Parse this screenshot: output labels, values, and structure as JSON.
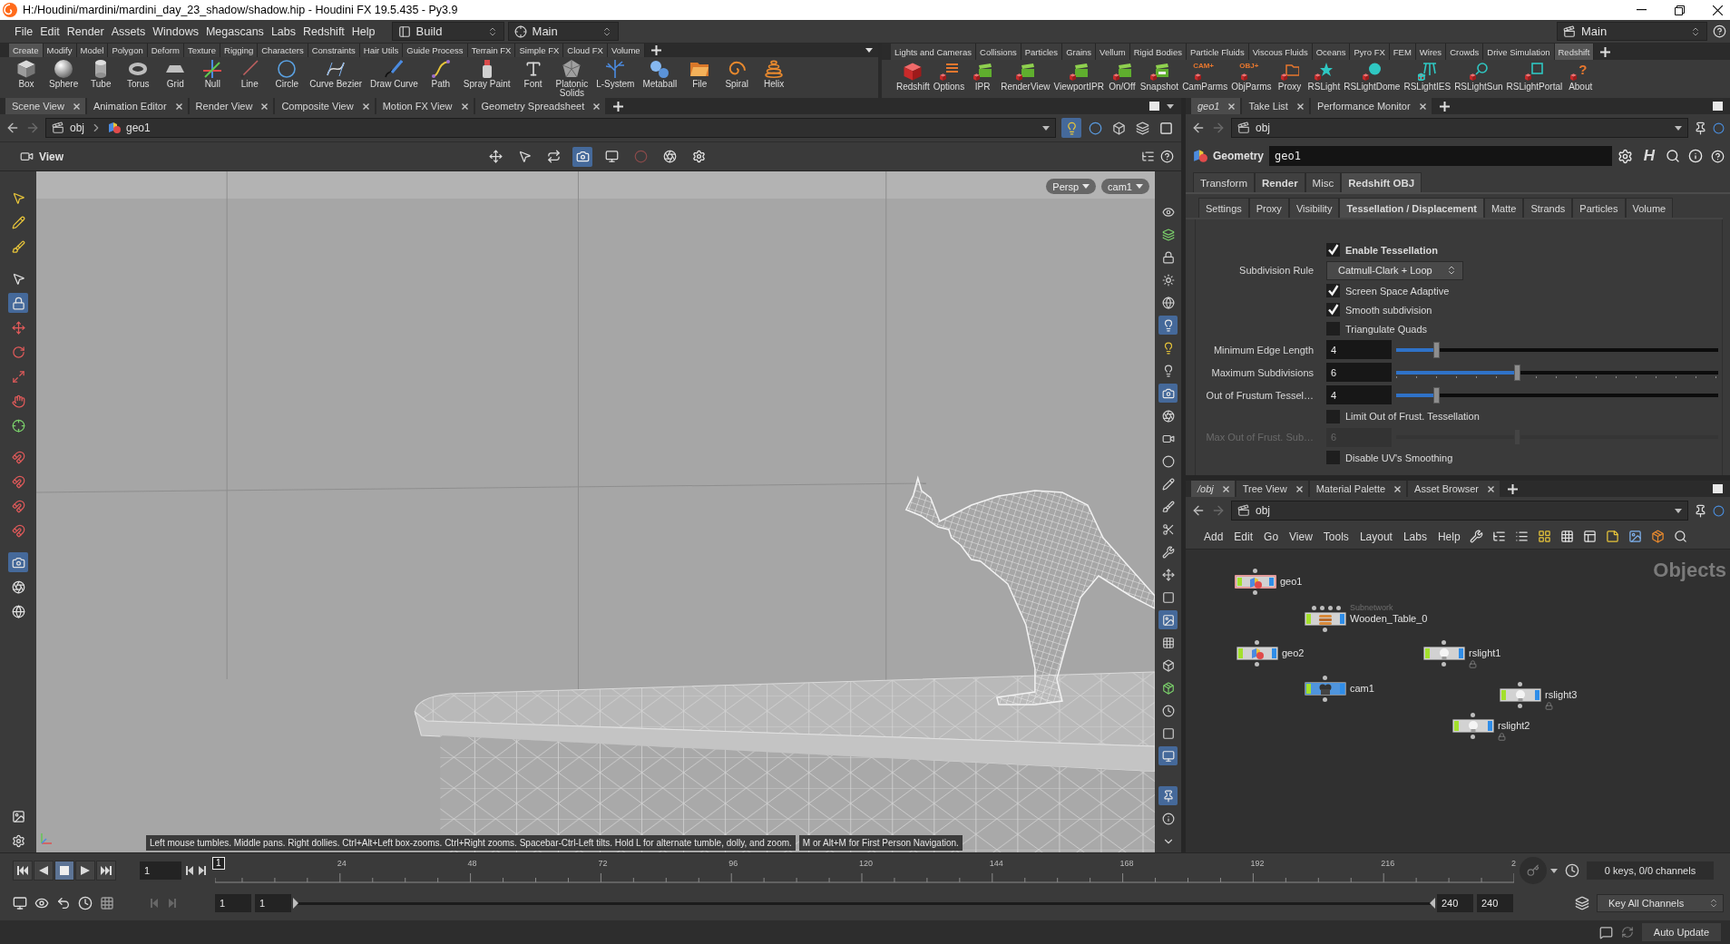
{
  "window": {
    "title": "H:/Houdini/mardini/mardini_day_23_shadow/shadow.hip - Houdini FX 19.5.435 - Py3.9"
  },
  "menu_bar": {
    "items": [
      "File",
      "Edit",
      "Render",
      "Assets",
      "Windows",
      "Megascans",
      "Labs",
      "Redshift",
      "Help"
    ],
    "desktop": "Build",
    "context": "Main",
    "right_context": "Main"
  },
  "shelves": [
    {
      "tabs": [
        {
          "label": "Create",
          "selected": true
        },
        {
          "label": "Modify",
          "selected": false
        },
        {
          "label": "Model",
          "selected": false
        },
        {
          "label": "Polygon",
          "selected": false
        },
        {
          "label": "Deform",
          "selected": false
        },
        {
          "label": "Texture",
          "selected": false
        },
        {
          "label": "Rigging",
          "selected": false
        },
        {
          "label": "Characters",
          "selected": false
        },
        {
          "label": "Constraints",
          "selected": false
        },
        {
          "label": "Hair Utils",
          "selected": false
        },
        {
          "label": "Guide Process",
          "selected": false
        },
        {
          "label": "Terrain FX",
          "selected": false
        },
        {
          "label": "Simple FX",
          "selected": false
        },
        {
          "label": "Cloud FX",
          "selected": false
        },
        {
          "label": "Volume",
          "selected": false
        }
      ],
      "tools": [
        {
          "label": "Box"
        },
        {
          "label": "Sphere"
        },
        {
          "label": "Tube"
        },
        {
          "label": "Torus"
        },
        {
          "label": "Grid"
        },
        {
          "label": "Null"
        },
        {
          "label": "Line"
        },
        {
          "label": "Circle"
        },
        {
          "label": "Curve Bezier"
        },
        {
          "label": "Draw Curve"
        },
        {
          "label": "Path"
        },
        {
          "label": "Spray Paint"
        },
        {
          "label": "Font"
        },
        {
          "label": "Platonic\nSolids"
        },
        {
          "label": "L-System"
        },
        {
          "label": "Metaball"
        },
        {
          "label": "File"
        },
        {
          "label": "Spiral"
        },
        {
          "label": "Helix"
        }
      ]
    },
    {
      "tabs": [
        {
          "label": "Lights and Cameras",
          "selected": false
        },
        {
          "label": "Collisions",
          "selected": false
        },
        {
          "label": "Particles",
          "selected": false
        },
        {
          "label": "Grains",
          "selected": false
        },
        {
          "label": "Vellum",
          "selected": false
        },
        {
          "label": "Rigid Bodies",
          "selected": false
        },
        {
          "label": "Particle Fluids",
          "selected": false
        },
        {
          "label": "Viscous Fluids",
          "selected": false
        },
        {
          "label": "Oceans",
          "selected": false
        },
        {
          "label": "Pyro FX",
          "selected": false
        },
        {
          "label": "FEM",
          "selected": false
        },
        {
          "label": "Wires",
          "selected": false
        },
        {
          "label": "Crowds",
          "selected": false
        },
        {
          "label": "Drive Simulation",
          "selected": false
        },
        {
          "label": "Redshift",
          "selected": true
        }
      ],
      "tools": [
        {
          "label": "Redshift"
        },
        {
          "label": "Options"
        },
        {
          "label": "IPR"
        },
        {
          "label": "RenderView"
        },
        {
          "label": "ViewportIPR"
        },
        {
          "label": "On/Off"
        },
        {
          "label": "Snapshot"
        },
        {
          "label": "CamParms",
          "icon_text": "CAM+"
        },
        {
          "label": "ObjParms",
          "icon_text": "OBJ+"
        },
        {
          "label": "Proxy"
        },
        {
          "label": "RSLight"
        },
        {
          "label": "RSLightDome"
        },
        {
          "label": "RSLightIES"
        },
        {
          "label": "RSLightSun"
        },
        {
          "label": "RSLightPortal"
        },
        {
          "label": "About",
          "icon_text": "?"
        }
      ]
    }
  ],
  "scene_viewer": {
    "tabs": [
      {
        "label": "Scene View",
        "selected": true
      },
      {
        "label": "Animation Editor",
        "selected": false
      },
      {
        "label": "Render View",
        "selected": false
      },
      {
        "label": "Composite View",
        "selected": false
      },
      {
        "label": "Motion FX View",
        "selected": false
      },
      {
        "label": "Geometry Spreadsheet",
        "selected": false
      }
    ],
    "path": [
      "obj",
      "geo1"
    ],
    "path_tools": [
      {
        "selected": true
      },
      {
        "selected": false
      },
      {
        "selected": false
      },
      {
        "selected": false
      },
      {
        "selected": false
      }
    ],
    "toolbar_title": "View",
    "view_toolbar": [
      {
        "selected": false
      },
      {
        "selected": false
      },
      {
        "selected": false
      },
      {
        "selected": true
      },
      {
        "selected": false
      },
      {
        "selected": false
      },
      {
        "selected": false
      },
      {
        "selected": false
      }
    ],
    "left_toolbar": [
      {
        "selected": false
      },
      {
        "selected": false
      },
      {
        "selected": false
      },
      {
        "selected": false
      },
      {
        "selected": true
      },
      {
        "selected": false
      },
      {
        "selected": false
      },
      {
        "selected": false
      },
      {
        "selected": false
      },
      {
        "selected": false
      },
      {
        "selected": false
      },
      {
        "selected": false
      },
      {
        "selected": false
      },
      {
        "selected": false
      },
      {
        "selected": true
      },
      {
        "selected": false
      },
      {
        "selected": false
      },
      {
        "selected": false
      },
      {
        "selected": false
      }
    ],
    "right_toolbar": [
      {
        "selected": false
      },
      {
        "selected": false
      },
      {
        "selected": false
      },
      {
        "selected": false
      },
      {
        "selected": false
      },
      {
        "selected": true
      },
      {
        "selected": false
      },
      {
        "selected": false
      },
      {
        "selected": true
      },
      {
        "selected": false
      },
      {
        "selected": false
      },
      {
        "selected": false
      },
      {
        "selected": false
      },
      {
        "selected": false
      },
      {
        "selected": false
      },
      {
        "selected": false
      },
      {
        "selected": false
      },
      {
        "selected": false
      },
      {
        "selected": true
      },
      {
        "selected": false
      },
      {
        "selected": false
      },
      {
        "selected": false
      },
      {
        "selected": false
      },
      {
        "selected": false
      },
      {
        "selected": true
      },
      {
        "selected": true
      },
      {
        "selected": false
      },
      {
        "selected": false
      }
    ],
    "view_menus": [
      "Persp",
      "cam1"
    ],
    "hints": [
      "Left mouse tumbles. Middle pans. Right dollies. Ctrl+Alt+Left box-zooms. Ctrl+Right zooms. Spacebar-Ctrl-Left tilts. Hold L for alternate tumble, dolly, and zoom.",
      "M or Alt+M for First Person Navigation."
    ]
  },
  "parameters": {
    "tabs": [
      {
        "label": "geo1",
        "selected": true,
        "linked": true
      },
      {
        "label": "Take List",
        "selected": false,
        "linked": false
      },
      {
        "label": "Performance Monitor",
        "selected": false,
        "linked": false
      }
    ],
    "path": "obj",
    "node_type": "Geometry",
    "node_name": "geo1",
    "menu_glyph": "H",
    "folders": [
      {
        "label": "Transform",
        "selected": false,
        "modified": false
      },
      {
        "label": "Render",
        "selected": false,
        "modified": true
      },
      {
        "label": "Misc",
        "selected": false,
        "modified": false
      },
      {
        "label": "Redshift OBJ",
        "selected": true,
        "modified": true
      }
    ],
    "subfolders": [
      {
        "label": "Settings",
        "selected": false,
        "modified": false
      },
      {
        "label": "Proxy",
        "selected": false,
        "modified": false
      },
      {
        "label": "Visibility",
        "selected": false,
        "modified": false
      },
      {
        "label": "Tessellation / Displacement",
        "selected": true,
        "modified": true
      },
      {
        "label": "Matte",
        "selected": false,
        "modified": false
      },
      {
        "label": "Strands",
        "selected": false,
        "modified": false
      },
      {
        "label": "Particles",
        "selected": false,
        "modified": false
      },
      {
        "label": "Volume",
        "selected": false,
        "modified": false
      }
    ],
    "rows": [
      {
        "kind": "checkbox",
        "label": "Enable Tessellation",
        "checked": true,
        "modified": true
      },
      {
        "kind": "menu",
        "label": "Subdivision Rule",
        "value": "Catmull-Clark + Loop"
      },
      {
        "kind": "checkbox",
        "label": "Screen Space Adaptive",
        "checked": true,
        "modified": false
      },
      {
        "kind": "checkbox",
        "label": "Smooth subdivision",
        "checked": true,
        "modified": false
      },
      {
        "kind": "checkbox",
        "label": "Triangulate Quads",
        "checked": false,
        "modified": false
      },
      {
        "kind": "slider",
        "label": "Minimum Edge Length",
        "value": "4",
        "level": 0.125,
        "disabled": false,
        "ticks": false
      },
      {
        "kind": "slider",
        "label": "Maximum Subdivisions",
        "value": "6",
        "level": 0.375,
        "disabled": false,
        "ticks": true
      },
      {
        "kind": "slider",
        "label": "Out of Frustum Tessel…",
        "value": "4",
        "level": 0.125,
        "disabled": false,
        "ticks": false
      },
      {
        "kind": "checkbox",
        "label": "Limit Out of Frust. Tessellation",
        "checked": false,
        "modified": false
      },
      {
        "kind": "slider",
        "label": "Max Out of Frust. Sub…",
        "value": "6",
        "level": 0.375,
        "disabled": true,
        "ticks": false
      },
      {
        "kind": "checkbox",
        "label": "Disable UV's Smoothing",
        "checked": false,
        "modified": false
      }
    ]
  },
  "network": {
    "tabs": [
      {
        "label": "/obj",
        "selected": true,
        "linked": true
      },
      {
        "label": "Tree View",
        "selected": false,
        "linked": false
      },
      {
        "label": "Material Palette",
        "selected": false,
        "linked": false
      },
      {
        "label": "Asset Browser",
        "selected": false,
        "linked": false
      }
    ],
    "path": "obj",
    "menu": [
      "Add",
      "Edit",
      "Go",
      "View",
      "Tools",
      "Layout",
      "Labs",
      "Help"
    ],
    "context_label": "Objects",
    "nodes": [
      {
        "name": "geo1",
        "kind": "geometry",
        "color": "#d2d2d2",
        "selected": true,
        "locked": false
      },
      {
        "name": "Wooden_Table_0",
        "subtitle": "Subnetwork",
        "kind": "subnet",
        "color": "#d2d2d2",
        "selected": false,
        "locked": false
      },
      {
        "name": "geo2",
        "kind": "geometry",
        "color": "#d2d2d2",
        "selected": false,
        "locked": false
      },
      {
        "name": "rslight1",
        "kind": "light",
        "color": "#d2d2d2",
        "selected": false,
        "locked": true
      },
      {
        "name": "cam1",
        "kind": "camera",
        "color": "#4f94dc",
        "selected": false,
        "locked": false
      },
      {
        "name": "rslight3",
        "kind": "light",
        "color": "#d2d2d2",
        "selected": false,
        "locked": true
      },
      {
        "name": "rslight2",
        "kind": "light",
        "color": "#d2d2d2",
        "selected": false,
        "locked": true
      }
    ]
  },
  "timeline": {
    "transport": [
      {
        "kind": "start",
        "selected": false
      },
      {
        "kind": "reverse",
        "selected": false
      },
      {
        "kind": "stop",
        "selected": true
      },
      {
        "kind": "play",
        "selected": false
      },
      {
        "kind": "end",
        "selected": false
      }
    ],
    "frame": "1",
    "marker": "1",
    "ticks": [
      "24",
      "48",
      "72",
      "96",
      "120",
      "144",
      "168",
      "192",
      "216",
      "2"
    ],
    "range_start": "1",
    "start": "1",
    "range_slider": {
      "level": 1
    },
    "range_end": "240",
    "end": "240",
    "keys": "0 keys, 0/0 channels",
    "key_button": "Key All Channels"
  },
  "status_bar": {
    "button": "Auto Update"
  }
}
